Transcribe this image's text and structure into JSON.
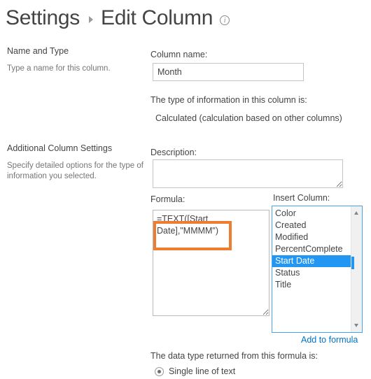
{
  "header": {
    "breadcrumb_root": "Settings",
    "breadcrumb_separator": "triangle-right-icon",
    "breadcrumb_current": "Edit Column",
    "info_icon": "info-icon",
    "info_glyph": "i"
  },
  "sections": [
    {
      "title": "Name and Type",
      "description": "Type a name for this column."
    },
    {
      "title": "Additional Column Settings",
      "description": "Specify detailed options for the type of information you selected."
    }
  ],
  "form": {
    "column_name_label": "Column name:",
    "column_name_value": "Month",
    "column_name_placeholder": "",
    "type_intro": "The type of information in this column is:",
    "type_value": "Calculated (calculation based on other columns)",
    "description_label": "Description:",
    "description_value": "",
    "description_placeholder": "",
    "formula_label": "Formula:",
    "formula_value": "=TEXT([Start Date],\"MMMM\")",
    "insert_column_label": "Insert Column:",
    "add_to_formula_link": "Add to formula",
    "datatype_intro": "The data type returned from this formula is:",
    "datatype_selected": "Single line of text"
  },
  "insert_column_options": [
    {
      "label": "Color",
      "selected": false
    },
    {
      "label": "Created",
      "selected": false
    },
    {
      "label": "Modified",
      "selected": false
    },
    {
      "label": "PercentComplete",
      "selected": false
    },
    {
      "label": "Start Date",
      "selected": true
    },
    {
      "label": "Status",
      "selected": false
    },
    {
      "label": "Title",
      "selected": false
    }
  ],
  "colors": {
    "annotation_orange": "#ED7D31",
    "selection_blue": "#2196F3",
    "link_blue": "#0072C6",
    "focus_border_blue": "#4AA3E8",
    "text_primary": "#444444",
    "text_secondary": "#767676",
    "field_border": "#C5C5C5"
  }
}
